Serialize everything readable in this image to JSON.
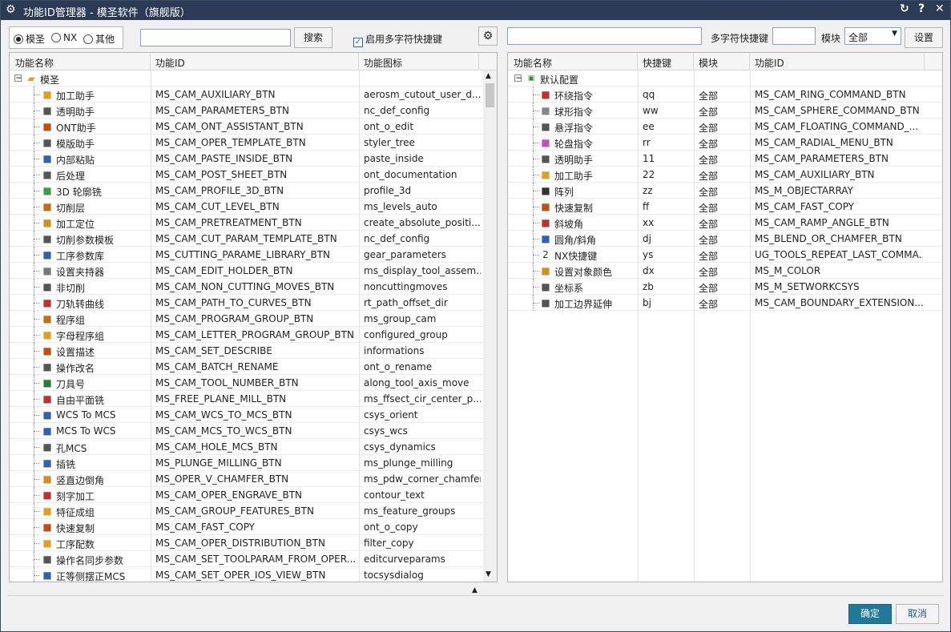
{
  "window": {
    "title": "功能ID管理器 - 模圣软件（旗舰版）",
    "controls": [
      "↻",
      "?",
      "✕"
    ]
  },
  "left": {
    "radios": [
      "模圣",
      "NX",
      "其他"
    ],
    "search_value": "",
    "search_btn": "搜索",
    "checkbox": "启用多字符快捷键",
    "columns": [
      "功能名称",
      "功能ID",
      "功能图标"
    ],
    "root": "模圣",
    "rows": [
      {
        "name": "加工助手",
        "id": "MS_CAM_AUXILIARY_BTN",
        "icon": "aerosm_cutout_user_d...",
        "ic": "folder-star-icon",
        "c": "#e0a020"
      },
      {
        "name": "透明助手",
        "id": "MS_CAM_PARAMETERS_BTN",
        "icon": "nc_def_config",
        "ic": "def-file-icon",
        "c": "#555"
      },
      {
        "name": "ONT助手",
        "id": "MS_CAM_ONT_ASSISTANT_BTN",
        "icon": "ont_o_edit",
        "ic": "edit-icon",
        "c": "#c05010"
      },
      {
        "name": "模版助手",
        "id": "MS_CAM_OPER_TEMPLATE_BTN",
        "icon": "styler_tree",
        "ic": "tree-icon",
        "c": "#555"
      },
      {
        "name": "内部粘贴",
        "id": "MS_CAM_PASTE_INSIDE_BTN",
        "icon": "paste_inside",
        "ic": "paste-icon",
        "c": "#3060b0"
      },
      {
        "name": "后处理",
        "id": "MS_CAM_POST_SHEET_BTN",
        "icon": "ont_documentation",
        "ic": "document-icon",
        "c": "#555"
      },
      {
        "name": "3D 轮廓铣",
        "id": "MS_CAM_PROFILE_3D_BTN",
        "icon": "profile_3d",
        "ic": "profile-3d-icon",
        "c": "#3a9a50"
      },
      {
        "name": "切削层",
        "id": "MS_CAM_CUT_LEVEL_BTN",
        "icon": "ms_levels_auto",
        "ic": "levels-icon",
        "c": "#c07010"
      },
      {
        "name": "加工定位",
        "id": "MS_CAM_PRETREATMENT_BTN",
        "icon": "create_absolute_positi...",
        "ic": "locate-icon",
        "c": "#d09020"
      },
      {
        "name": "切削参数模板",
        "id": "MS_CAM_CUT_PARAM_TEMPLATE_BTN",
        "icon": "nc_def_config",
        "ic": "def-file-icon",
        "c": "#555"
      },
      {
        "name": "工序参数库",
        "id": "MS_CUTTING_PARAME_LIBRARY_BTN",
        "icon": "gear_parameters",
        "ic": "gear-library-icon",
        "c": "#3060b0"
      },
      {
        "name": "设置夹持器",
        "id": "MS_CAM_EDIT_HOLDER_BTN",
        "icon": "ms_display_tool_assem...",
        "ic": "holder-icon",
        "c": "#777"
      },
      {
        "name": "非切削",
        "id": "MS_CAM_NON_CUTTING_MOVES_BTN",
        "icon": "noncuttingmoves",
        "ic": "eye-icon",
        "c": "#555"
      },
      {
        "name": "刀轨转曲线",
        "id": "MS_CAM_PATH_TO_CURVES_BTN",
        "icon": "rt_path_offset_dir",
        "ic": "path-curve-icon",
        "c": "#c03030"
      },
      {
        "name": "程序组",
        "id": "MS_CAM_PROGRAM_GROUP_BTN",
        "icon": "ms_group_cam",
        "ic": "program-group-icon",
        "c": "#c07010"
      },
      {
        "name": "字母程序组",
        "id": "MS_CAM_LETTER_PROGRAM_GROUP_BTN",
        "icon": "configured_group",
        "ic": "folder-icon",
        "c": "#e0a020"
      },
      {
        "name": "设置描述",
        "id": "MS_CAM_SET_DESCRIBE",
        "icon": "informations",
        "ic": "info-icon",
        "c": "#c05010"
      },
      {
        "name": "操作改名",
        "id": "MS_CAM_BATCH_RENAME",
        "icon": "ont_o_rename",
        "ic": "rename-icon",
        "c": "#555"
      },
      {
        "name": "刀具号",
        "id": "MS_CAM_TOOL_NUMBER_BTN",
        "icon": "along_tool_axis_move",
        "ic": "tool-number-icon",
        "c": "#2a7a40"
      },
      {
        "name": "自由平面铣",
        "id": "MS_FREE_PLANE_MILL_BTN",
        "icon": "ms_ffsect_cir_center_p...",
        "ic": "plane-mill-icon",
        "c": "#c03030"
      },
      {
        "name": "WCS To MCS",
        "id": "MS_CAM_WCS_TO_MCS_BTN",
        "icon": "csys_orient",
        "ic": "csys-orient-icon",
        "c": "#3060b0"
      },
      {
        "name": "MCS To WCS",
        "id": "MS_CAM_MCS_TO_WCS_BTN",
        "icon": "csys_wcs",
        "ic": "csys-wcs-icon",
        "c": "#3060b0"
      },
      {
        "name": "孔MCS",
        "id": "MS_CAM_HOLE_MCS_BTN",
        "icon": "csys_dynamics",
        "ic": "csys-dynamics-icon",
        "c": "#555"
      },
      {
        "name": "插铣",
        "id": "MS_PLUNGE_MILLING_BTN",
        "icon": "ms_plunge_milling",
        "ic": "plunge-icon",
        "c": "#3060b0"
      },
      {
        "name": "竖直边倒角",
        "id": "MS_OPER_V_CHAMFER_BTN",
        "icon": "ms_pdw_corner_chamfer",
        "ic": "chamfer-icon",
        "c": "#d09020"
      },
      {
        "name": "刻字加工",
        "id": "MS_CAM_OPER_ENGRAVE_BTN",
        "icon": "contour_text",
        "ic": "engrave-icon",
        "c": "#c03030"
      },
      {
        "name": "特征成组",
        "id": "MS_CAM_GROUP_FEATURES_BTN",
        "icon": "ms_feature_groups",
        "ic": "feature-group-icon",
        "c": "#e0a020"
      },
      {
        "name": "快速复制",
        "id": "MS_CAM_FAST_COPY",
        "icon": "ont_o_copy",
        "ic": "copy-icon",
        "c": "#c05010"
      },
      {
        "name": "工序配数",
        "id": "MS_CAM_OPER_DISTRIBUTION_BTN",
        "icon": "filter_copy",
        "ic": "filter-icon",
        "c": "#e0a020"
      },
      {
        "name": "操作名同步参数",
        "id": "MS_CAM_SET_TOOLPARAM_FROM_OPER...",
        "icon": "editcurveparams",
        "ic": "curve-params-icon",
        "c": "#555"
      },
      {
        "name": "正等侧摆正MCS",
        "id": "MS_CAM_SET_OPER_IOS_VIEW_BTN",
        "icon": "tocsysdialog",
        "ic": "csys-dialog-icon",
        "c": "#3060b0"
      }
    ]
  },
  "right": {
    "search_value": "",
    "shortcut_label": "多字符快捷键",
    "shortcut_value": "",
    "module_label": "模块",
    "module_value": "全部",
    "settings_btn": "设置",
    "columns": [
      "功能名称",
      "快捷键",
      "模块",
      "功能ID"
    ],
    "root": "默认配置",
    "rows": [
      {
        "name": "环绕指令",
        "key": "qq",
        "mod": "全部",
        "id": "MS_CAM_RING_COMMAND_BTN",
        "ic": "ring-icon",
        "c": "#c03030"
      },
      {
        "name": "球形指令",
        "key": "ww",
        "mod": "全部",
        "id": "MS_CAM_SPHERE_COMMAND_BTN",
        "ic": "sphere-icon",
        "c": "#888"
      },
      {
        "name": "悬浮指令",
        "key": "ee",
        "mod": "全部",
        "id": "MS_CAM_FLOATING_COMMAND_...",
        "ic": "floating-icon",
        "c": "#555"
      },
      {
        "name": "轮盘指令",
        "key": "rr",
        "mod": "全部",
        "id": "MS_CAM_RADIAL_MENU_BTN",
        "ic": "radial-icon",
        "c": "#c050c0"
      },
      {
        "name": "透明助手",
        "key": "11",
        "mod": "全部",
        "id": "MS_CAM_PARAMETERS_BTN",
        "ic": "def-file-icon",
        "c": "#555"
      },
      {
        "name": "加工助手",
        "key": "22",
        "mod": "全部",
        "id": "MS_CAM_AUXILIARY_BTN",
        "ic": "folder-star-icon",
        "c": "#e0a020"
      },
      {
        "name": "阵列",
        "key": "zz",
        "mod": "全部",
        "id": "MS_M_OBJECTARRAY",
        "ic": "array-icon",
        "c": "#333"
      },
      {
        "name": "快速复制",
        "key": "ff",
        "mod": "全部",
        "id": "MS_CAM_FAST_COPY",
        "ic": "copy-icon",
        "c": "#c05010"
      },
      {
        "name": "斜坡角",
        "key": "xx",
        "mod": "全部",
        "id": "MS_CAM_RAMP_ANGLE_BTN",
        "ic": "ramp-icon",
        "c": "#c03030"
      },
      {
        "name": "圆角/斜角",
        "key": "dj",
        "mod": "全部",
        "id": "MS_BLEND_OR_CHAMFER_BTN",
        "ic": "blend-icon",
        "c": "#3060b0"
      },
      {
        "name": "NX快捷键",
        "key": "ys",
        "mod": "全部",
        "id": "UG_TOOLS_REPEAT_LAST_COMMA...",
        "ic": "number-2-icon",
        "c": "#333",
        "glyph": "2"
      },
      {
        "name": "设置对象颜色",
        "key": "dx",
        "mod": "全部",
        "id": "MS_M_COLOR",
        "ic": "color-icon",
        "c": "#d09020"
      },
      {
        "name": "坐标系",
        "key": "zb",
        "mod": "全部",
        "id": "MS_M_SETWORKCSYS",
        "ic": "csys-icon",
        "c": "#555"
      },
      {
        "name": "加工边界延伸",
        "key": "bj",
        "mod": "全部",
        "id": "MS_CAM_BOUNDARY_EXTENSION...",
        "ic": "boundary-icon",
        "c": "#555"
      }
    ]
  },
  "footer": {
    "ok": "确定",
    "cancel": "取消"
  }
}
